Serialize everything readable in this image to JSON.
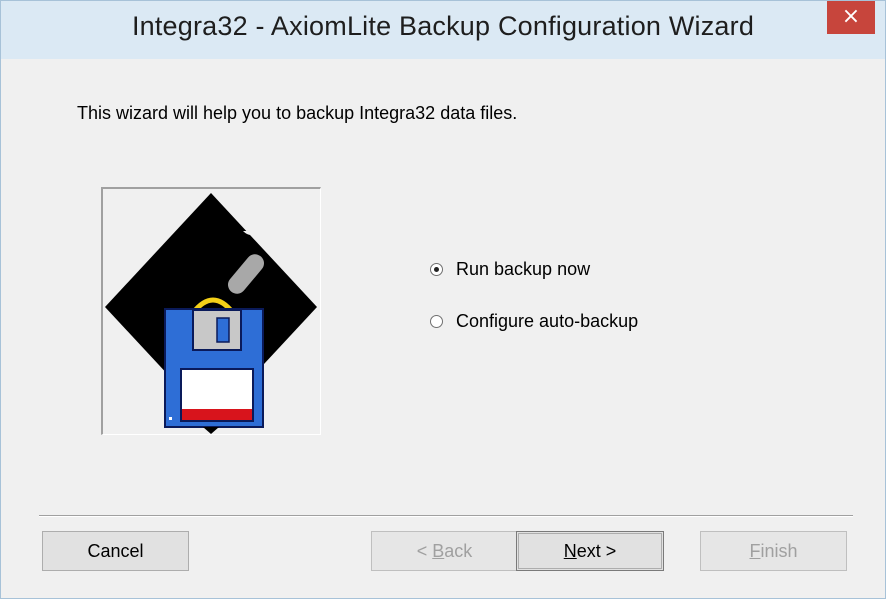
{
  "window": {
    "title": "Integra32 - AxiomLite Backup Configuration Wizard",
    "close_glyph": "×"
  },
  "intro_text": "This wizard will help you to backup Integra32 data files.",
  "image": {
    "icon": "floppy-disk-backup-icon"
  },
  "options": [
    {
      "label": "Run backup now",
      "checked": true
    },
    {
      "label": "Configure auto-backup",
      "checked": false
    }
  ],
  "buttons": {
    "cancel": {
      "label": "Cancel",
      "enabled": true
    },
    "back": {
      "prefix": "< ",
      "mnemonic": "B",
      "rest": "ack",
      "enabled": false
    },
    "next": {
      "mnemonic": "N",
      "rest": "ext >",
      "enabled": true
    },
    "finish": {
      "mnemonic": "F",
      "rest": "inish",
      "enabled": false
    }
  },
  "colors": {
    "titlebar": "#dbe9f4",
    "close": "#c7453c",
    "floppy_blue": "#2e6ed6",
    "floppy_label_stripe": "#d8141c"
  }
}
